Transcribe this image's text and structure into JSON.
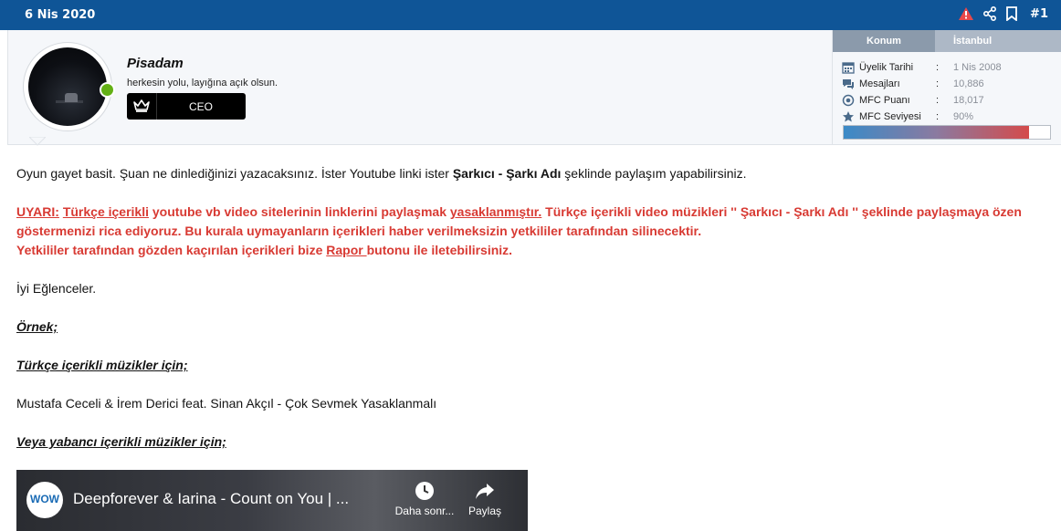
{
  "post": {
    "date": "6 Nis 2020",
    "number": "#1"
  },
  "user": {
    "name": "Pisadam",
    "title": "herkesin yolu, layığına açık olsun.",
    "rank": "CEO",
    "location_label": "Konum",
    "location_value": "İstanbul",
    "stats": [
      {
        "icon": "calendar-icon",
        "label": "Üyelik Tarihi",
        "value": "1 Nis 2008"
      },
      {
        "icon": "messages-icon",
        "label": "Mesajları",
        "value": "10,886"
      },
      {
        "icon": "points-icon",
        "label": "MFC Puanı",
        "value": "18,017"
      },
      {
        "icon": "star-icon",
        "label": "MFC Seviyesi",
        "value": "90%"
      }
    ],
    "level_fraction": 0.9
  },
  "content": {
    "intro_1": "Oyun gayet basit. Şuan ne dinlediğinizi yazacaksınız. İster Youtube linki ister ",
    "intro_bold": "Şarkıcı - Şarkı Adı",
    "intro_2": " şeklinde paylaşım yapabilirsiniz.",
    "warn_label": "UYARI:",
    "warn_link": "Türkçe içerikli",
    "warn_1": " youtube vb video sitelerinin linklerini paylaşmak ",
    "warn_link2": "yasaklanmıştır.",
    "warn_2": " Türkçe içerikli video müzikleri '' Şarkıcı - Şarkı Adı '' şeklinde paylaşmaya özen göstermenizi rica ediyoruz. Bu kurala uymayanların içerikleri haber verilmeksizin yetkililer tarafından silinecektir.",
    "warn_3": "Yetkililer tarafından gözden kaçırılan içerikleri bize ",
    "warn_link3": "Rapor ",
    "warn_4": "butonu ile iletebilirsiniz.",
    "fun": "İyi Eğlenceler.",
    "example": "Örnek;",
    "turkish_heading": "Türkçe içerikli müzikler için;",
    "turkish_example": "Mustafa Ceceli & İrem Derici feat. Sinan Akçıl - Çok Sevmek Yasaklanmalı",
    "foreign_heading": "Veya yabancı içerikli müzikler için;"
  },
  "video": {
    "channel_logo": "WOW",
    "title": "Deepforever & Iarina - Count on You | ...",
    "later_label": "Daha sonr...",
    "share_label": "Paylaş"
  }
}
